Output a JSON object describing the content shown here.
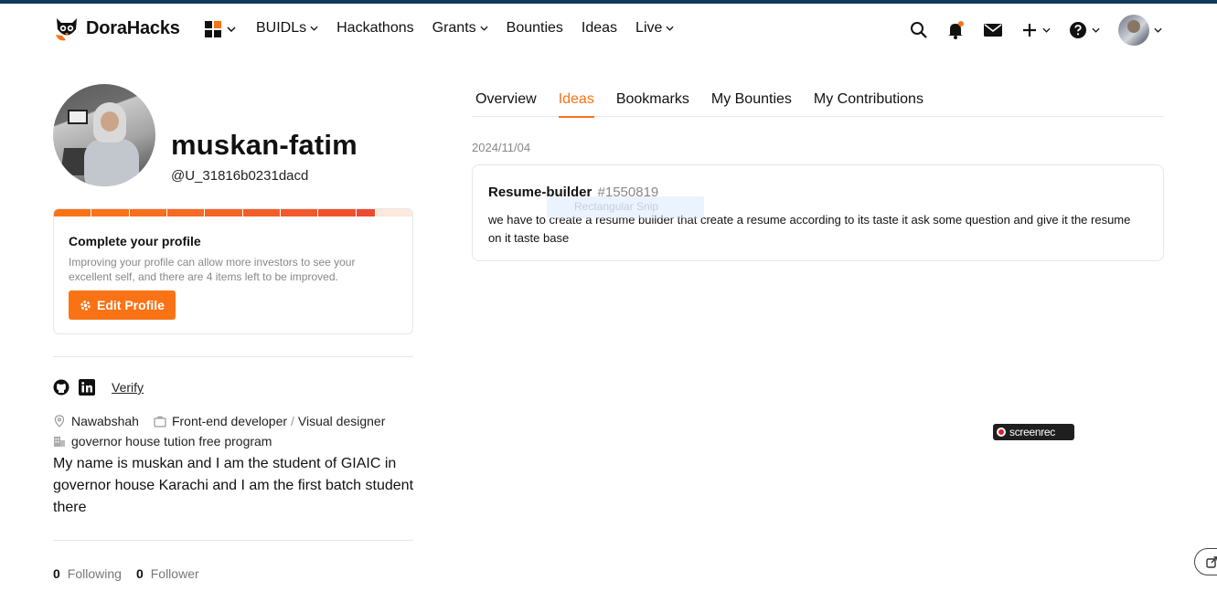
{
  "brand": {
    "name": "DoraHacks"
  },
  "nav": {
    "items": [
      {
        "label": "BUIDLs",
        "dropdown": true
      },
      {
        "label": "Hackathons",
        "dropdown": false
      },
      {
        "label": "Grants",
        "dropdown": true
      },
      {
        "label": "Bounties",
        "dropdown": false
      },
      {
        "label": "Ideas",
        "dropdown": false
      },
      {
        "label": "Live",
        "dropdown": true
      }
    ],
    "right_icons": [
      "search-icon",
      "bell-icon",
      "mail-icon",
      "plus-icon",
      "help-icon",
      "avatar"
    ]
  },
  "profile": {
    "name": "muskan-fatim",
    "handle": "@U_31816b0231dacd",
    "completion": {
      "title": "Complete your profile",
      "description": "Improving your profile can allow more investors to see your excellent self, and there are 4 items left to be improved.",
      "edit_label": "Edit Profile",
      "progress_filled": 9,
      "progress_total": 10
    },
    "verify_label": "Verify",
    "location": "Nawabshah",
    "role_primary": "Front-end developer",
    "role_separator": "/",
    "role_secondary": "Visual designer",
    "organization": "governor house tution free program",
    "bio": "My name is muskan and I am the student of GIAIC in governor house Karachi and I am the first batch student there",
    "following_count": "0",
    "following_label": "Following",
    "follower_count": "0",
    "follower_label": "Follower"
  },
  "tabs": [
    {
      "label": "Overview",
      "active": false
    },
    {
      "label": "Ideas",
      "active": true
    },
    {
      "label": "Bookmarks",
      "active": false
    },
    {
      "label": "My Bounties",
      "active": false
    },
    {
      "label": "My Contributions",
      "active": false
    }
  ],
  "ideas": {
    "date": "2024/11/04",
    "title": "Resume-builder",
    "number": "#1550819",
    "description": "we have to create a resume builder that create a resume according to its taste it ask some question and give it the resume on it taste base"
  },
  "overlay": {
    "ghost_text": "Rectangular Snip",
    "screenrec_label": "screenrec"
  },
  "colors": {
    "accent": "#f97316",
    "topbar": "#0f3a5c"
  }
}
